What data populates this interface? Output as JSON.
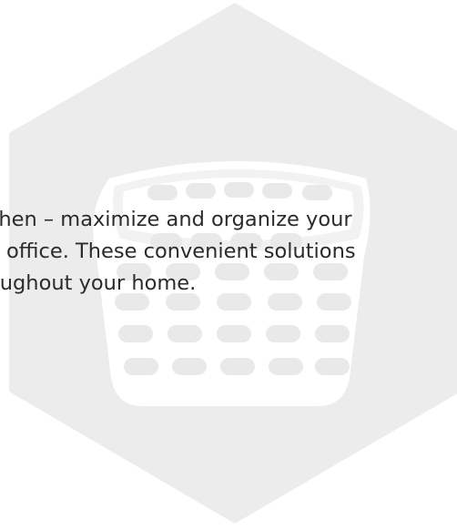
{
  "badge": {
    "icon": "basket-icon",
    "background_color": "#ececec",
    "icon_color": "#ffffff"
  },
  "text": {
    "lines": [
      "chen – maximize and organize your",
      "e office. These convenient solutions",
      "oughout your home."
    ]
  }
}
